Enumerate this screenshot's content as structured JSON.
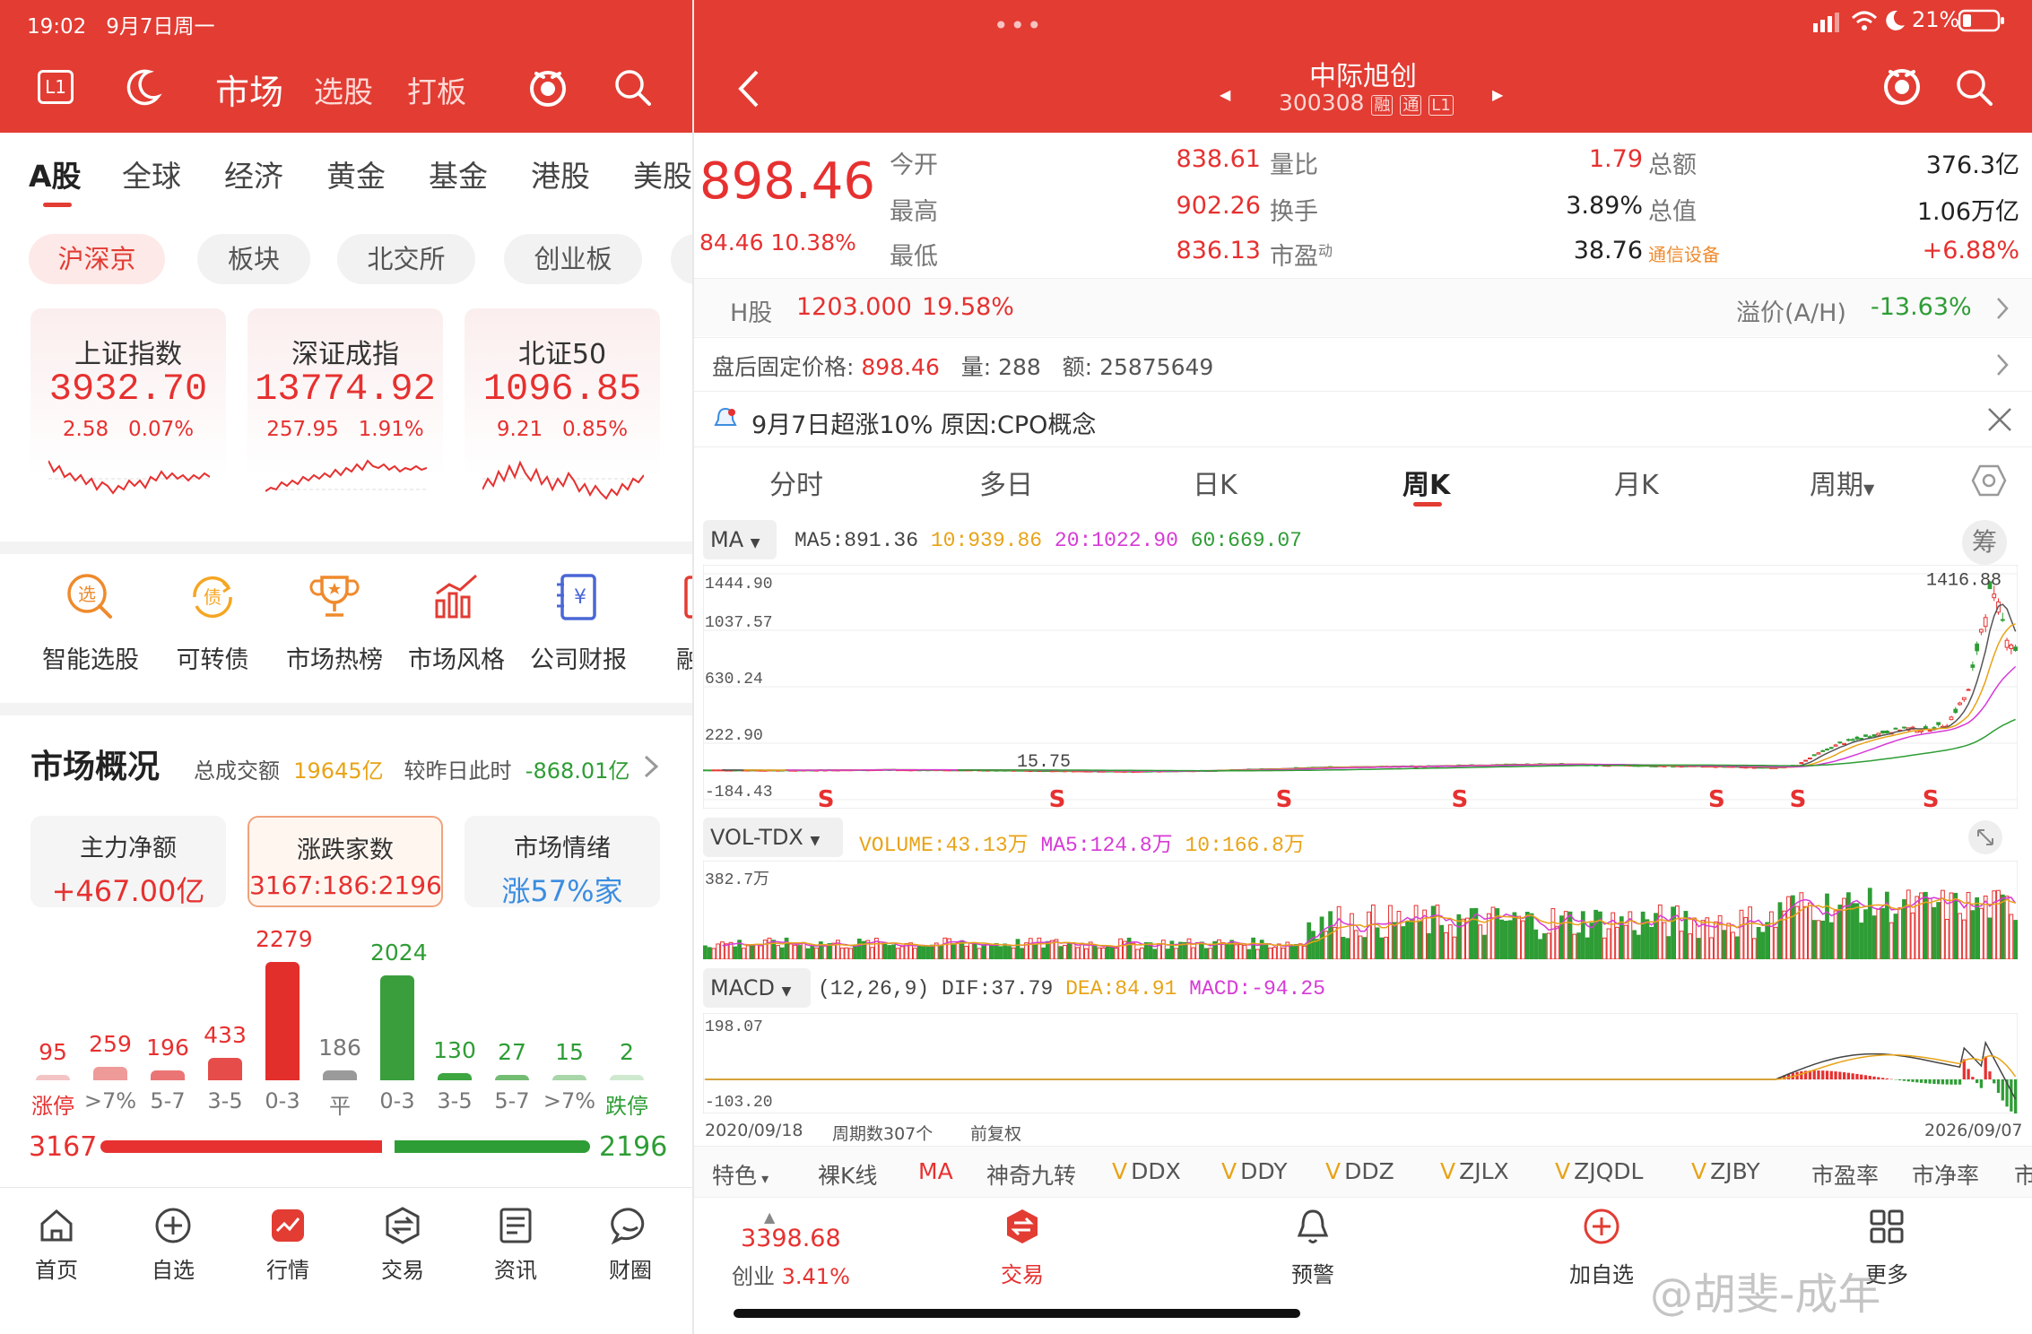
{
  "left": {
    "status": {
      "time": "19:02",
      "date": "9月7日周一"
    },
    "header": {
      "l1": "L1",
      "tab_active": "市场",
      "tab2": "选股",
      "tab3": "打板"
    },
    "categories": [
      "A股",
      "全球",
      "经济",
      "黄金",
      "基金",
      "港股",
      "美股"
    ],
    "pills": [
      "沪深京",
      "板块",
      "北交所",
      "创业板"
    ],
    "indices": [
      {
        "name": "上证指数",
        "value": "3932.70",
        "chg": "2.58",
        "pct": "0.07%"
      },
      {
        "name": "深证成指",
        "value": "13774.92",
        "chg": "257.95",
        "pct": "1.91%"
      },
      {
        "name": "北证50",
        "value": "1096.85",
        "chg": "9.21",
        "pct": "0.85%"
      }
    ],
    "tools": [
      "智能选股",
      "可转债",
      "市场热榜",
      "市场风格",
      "公司财报",
      "融资"
    ],
    "tool_glyphs": {
      "select": "选",
      "bond": "债",
      "report": "¥"
    },
    "overview": {
      "title": "市场概况",
      "turnover_label": "总成交额",
      "turnover": "19645亿",
      "cmp_label": "较昨日此时",
      "cmp": "-868.01亿"
    },
    "cards": [
      {
        "title": "主力净额",
        "value": "+467.00亿",
        "color": "#e63130"
      },
      {
        "title": "涨跌家数",
        "value": "3167:186:2196",
        "color": "#e63130"
      },
      {
        "title": "市场情绪",
        "value": "涨57%家",
        "color": "#3b8de0"
      }
    ],
    "dist": [
      {
        "label": "涨停",
        "value": "95",
        "count": 95,
        "color": "#f3c4c4",
        "lcolor": "#e63130"
      },
      {
        "label": ">7%",
        "value": "259",
        "count": 259,
        "color": "#ee9a99",
        "lcolor": "#777"
      },
      {
        "label": "5-7",
        "value": "196",
        "count": 196,
        "color": "#ea7574",
        "lcolor": "#777"
      },
      {
        "label": "3-5",
        "value": "433",
        "count": 433,
        "color": "#e54c4a",
        "lcolor": "#777"
      },
      {
        "label": "0-3",
        "value": "2279",
        "count": 2279,
        "color": "#e32f2c",
        "lcolor": "#777"
      },
      {
        "label": "平",
        "value": "186",
        "count": 186,
        "color": "#9a9a9a",
        "lcolor": "#777"
      },
      {
        "label": "0-3",
        "value": "2024",
        "count": 2024,
        "color": "#3a9e3d",
        "lcolor": "#777"
      },
      {
        "label": "3-5",
        "value": "130",
        "count": 130,
        "color": "#3da640",
        "lcolor": "#777"
      },
      {
        "label": "5-7",
        "value": "27",
        "count": 27,
        "color": "#73bd73",
        "lcolor": "#777"
      },
      {
        "label": ">7%",
        "value": "15",
        "count": 15,
        "color": "#a9d6a8",
        "lcolor": "#777"
      },
      {
        "label": "跌停",
        "value": "2",
        "count": 2,
        "color": "#cfe9cf",
        "lcolor": "#2e9d35"
      }
    ],
    "updown": {
      "up": "3167",
      "down": "2196",
      "up_count": 3167,
      "down_count": 2196
    },
    "nav": [
      "首页",
      "自选",
      "行情",
      "交易",
      "资讯",
      "财圈"
    ]
  },
  "right": {
    "status": {
      "battery": "21%"
    },
    "stock": {
      "name": "中际旭创",
      "code": "300308",
      "tags": [
        "融",
        "通",
        "L1"
      ]
    },
    "price": "898.46",
    "chg": "84.46",
    "pct": "10.38%",
    "quote": [
      {
        "k": "今开",
        "v": "838.61",
        "k2": "量比",
        "v2": "1.79",
        "k3": "总额",
        "v3": "376.3亿"
      },
      {
        "k": "最高",
        "v": "902.26",
        "k2": "换手",
        "v2": "3.89%",
        "k3": "总值",
        "v3": "1.06万亿"
      },
      {
        "k": "最低",
        "v": "836.13",
        "k2": "市盈",
        "k2sup": "动",
        "v2": "38.76",
        "k3": "通信设备",
        "v3": "+6.88%"
      }
    ],
    "hshare": {
      "label": "H股",
      "price": "1203.000",
      "pct": "19.58%",
      "prem_label": "溢价(A/H)",
      "prem": "-13.63%"
    },
    "after": {
      "l1": "盘后固定价格:",
      "v1": "898.46",
      "l2": "量:",
      "v2": "288",
      "l3": "额:",
      "v3": "25875649"
    },
    "news": "9月7日超涨10% 原因:CPO概念",
    "ktabs": [
      "分时",
      "多日",
      "日K",
      "周K",
      "月K",
      "周期"
    ],
    "ma": {
      "label": "MA",
      "ma5": "MA5:891.36",
      "ma10": "10:939.86",
      "ma20": "20:1022.90",
      "ma60": "60:669.07",
      "chip": "筹"
    },
    "vol": {
      "label": "VOL-TDX",
      "volume": "VOLUME:43.13万",
      "ma5": "MA5:124.8万",
      "ma10": "10:166.8万",
      "ymax": "382.7万"
    },
    "macd": {
      "label": "MACD",
      "params": "(12,26,9)",
      "dif": "DIF:37.79",
      "dea": "DEA:84.91",
      "macd": "MACD:-94.25",
      "ymax": "198.07",
      "ymin": "-103.20"
    },
    "axis": {
      "start": "2020/09/18",
      "periods": "周期数307个",
      "adj": "前复权",
      "end": "2026/09/07"
    },
    "indicators": [
      "特色",
      "裸K线",
      "MA",
      "神奇九转",
      "DDX",
      "DDY",
      "DDZ",
      "ZJLX",
      "ZJQDL",
      "ZJBY",
      "市盈率",
      "市净率",
      "市"
    ],
    "vtag": "V",
    "bottom": {
      "idx_value": "3398.68",
      "idx_name": "创业",
      "idx_pct": "3.41%",
      "trade": "交易",
      "alert": "预警",
      "add": "加自选",
      "more": "更多"
    },
    "watermark": "@胡斐-成年",
    "colors": {
      "up": "#e63130",
      "down": "#2e9d35",
      "ma5": "#555555",
      "ma10": "#e8a317",
      "ma20": "#d63ad6",
      "ma60": "#2e9d35"
    }
  },
  "chart_data": {
    "type": "candlestick",
    "title": "中际旭创 周K",
    "price_axis": {
      "ticks": [
        "1444.90",
        "1037.57",
        "630.24",
        "222.90",
        "-184.43"
      ],
      "max": 1444.9,
      "min": -184.43
    },
    "high_label": "1416.88",
    "low_label": "15.75",
    "signals": [
      "S",
      "S",
      "S",
      "S",
      "S",
      "S",
      "S"
    ],
    "x_range": [
      "2020/09/18",
      "2026/09/07"
    ],
    "periods": 307,
    "close_keypoints": [
      [
        0,
        30
      ],
      [
        20,
        28
      ],
      [
        40,
        32
      ],
      [
        60,
        30
      ],
      [
        80,
        25
      ],
      [
        100,
        20
      ],
      [
        120,
        27
      ],
      [
        140,
        45
      ],
      [
        150,
        52
      ],
      [
        170,
        58
      ],
      [
        190,
        70
      ],
      [
        200,
        72
      ],
      [
        220,
        60
      ],
      [
        240,
        55
      ],
      [
        250,
        45
      ],
      [
        255,
        65
      ],
      [
        260,
        150
      ],
      [
        265,
        220
      ],
      [
        270,
        260
      ],
      [
        275,
        300
      ],
      [
        280,
        330
      ],
      [
        285,
        320
      ],
      [
        290,
        360
      ],
      [
        295,
        600
      ],
      [
        298,
        1050
      ],
      [
        300,
        1300
      ],
      [
        302,
        1200
      ],
      [
        304,
        1000
      ],
      [
        306,
        898
      ]
    ]
  }
}
